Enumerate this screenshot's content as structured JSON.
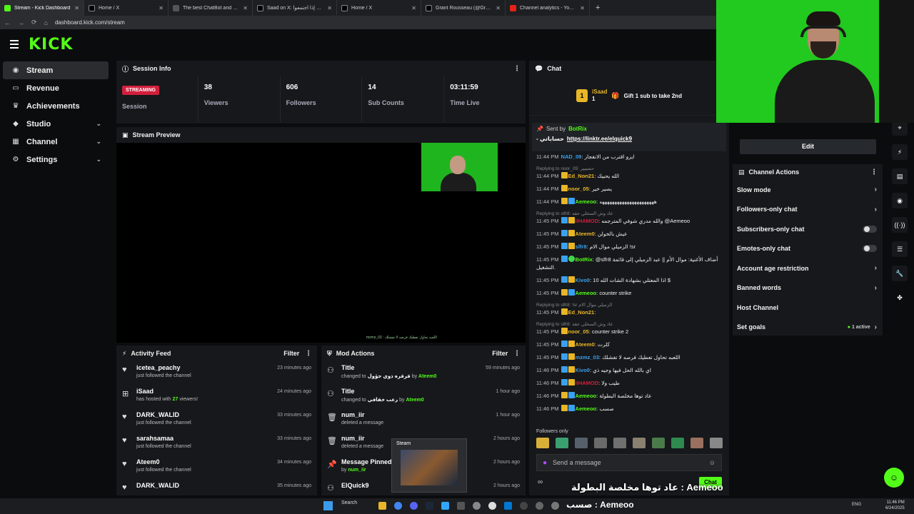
{
  "browser": {
    "tabs": [
      {
        "title": "Stream - Kick Dashboard",
        "icon": "kick-icon",
        "active": true
      },
      {
        "title": "Home / X",
        "icon": "x-icon"
      },
      {
        "title": "The best ChatBot and Widgets",
        "icon": "botrix-icon"
      },
      {
        "title": "Saad on X: وكويك إذا اجتمعوا",
        "icon": "x-icon"
      },
      {
        "title": "Home / X",
        "icon": "x-icon"
      },
      {
        "title": "Grant Rousseau (@GrantRous...",
        "icon": "x-icon"
      },
      {
        "title": "Channel analytics - YouTube St...",
        "icon": "youtube-icon"
      }
    ],
    "url": "dashboard.kick.com/stream"
  },
  "brand": {
    "logo": "KICK",
    "accent": "#53fc18"
  },
  "sidebar": {
    "items": [
      {
        "label": "Stream",
        "icon": "stream-icon"
      },
      {
        "label": "Revenue",
        "icon": "wallet-icon"
      },
      {
        "label": "Achievements",
        "icon": "trophy-icon"
      },
      {
        "label": "Studio",
        "icon": "location-icon"
      },
      {
        "label": "Channel",
        "icon": "channel-icon"
      },
      {
        "label": "Settings",
        "icon": "gear-icon"
      }
    ]
  },
  "session": {
    "title": "Session Info",
    "status": "STREAMING",
    "status_label": "Session",
    "stats": [
      {
        "value": "38",
        "label": "Viewers"
      },
      {
        "value": "606",
        "label": "Followers"
      },
      {
        "value": "14",
        "label": "Sub Counts"
      },
      {
        "value": "03:11:59",
        "label": "Time Live"
      }
    ]
  },
  "preview": {
    "title": "Stream Preview",
    "ticker": "mzmz_03 : اللعبه تحاول تعطيك فرصه لا تفشلك"
  },
  "activity": {
    "title": "Activity Feed",
    "filter": "Filter",
    "rows": [
      {
        "name": "icetea_peachy",
        "desc": "just followed the channel",
        "time": "23 minutes ago",
        "icon": "heart-icon"
      },
      {
        "name": "iSaad",
        "desc_pre": "has hosted with",
        "desc_num": "27",
        "desc_post": "viewers!",
        "time": "24 minutes ago",
        "icon": "host-icon"
      },
      {
        "name": "DARK_WALID",
        "desc": "just followed the channel",
        "time": "33 minutes ago",
        "icon": "heart-icon"
      },
      {
        "name": "sarahsamaa",
        "desc": "just followed the channel",
        "time": "33 minutes ago",
        "icon": "heart-icon"
      },
      {
        "name": "Ateem0",
        "desc": "just followed the channel",
        "time": "34 minutes ago",
        "icon": "heart-icon"
      },
      {
        "name": "DARK_WALID",
        "desc": "",
        "time": "35 minutes ago",
        "icon": "heart-icon"
      }
    ]
  },
  "modactions": {
    "title": "Mod Actions",
    "filter": "Filter",
    "rows": [
      {
        "name": "Title",
        "desc_pre": "changed to",
        "desc_bold": "قرقره ذوي جؤول",
        "by": "by",
        "user": "Ateem0",
        "time": "59 minutes ago",
        "icon": "users-icon"
      },
      {
        "name": "Title",
        "desc_pre": "changed to",
        "desc_bold": "رعب خفافي",
        "by": "by",
        "user": "Ateem0",
        "time": "1 hour ago",
        "icon": "users-icon"
      },
      {
        "name": "num_iir",
        "desc_pre": "deleted a message",
        "time": "1 hour ago",
        "icon": "trash-icon"
      },
      {
        "name": "num_iir",
        "desc_pre": "deleted a message",
        "time": "2 hours ago",
        "icon": "trash-icon"
      },
      {
        "name": "Message Pinned",
        "desc_pre": "by",
        "user": "num_iir",
        "time": "2 hours ago",
        "icon": "pin-icon"
      },
      {
        "name": "ElQuick9",
        "desc_pre": "",
        "time": "2 hours ago",
        "icon": "users-icon"
      }
    ]
  },
  "chat": {
    "title": "Chat",
    "gifter": {
      "name": "iSaad",
      "count": "1",
      "rank": "1",
      "text": "Gift 1 sub to take 2nd"
    },
    "pinned": {
      "sent_by": "Sent by",
      "user": "BotRix",
      "text": "حساباتي -",
      "link": "https://linktr.ee/elquick9"
    },
    "messages": [
      {
        "time": "11:44 PM",
        "user": "NAD_09",
        "color": "#3aa0f0",
        "text": "ايزو اقترب من الانفجار",
        "badges": []
      },
      {
        "reply": "Replying to noor_05: حسیبپر"
      },
      {
        "time": "11:44 PM",
        "user": "Ed_Non21",
        "color": "#e9b628",
        "text": "الله يحبيك",
        "badges": [
          "gold"
        ]
      },
      {
        "time": "11:44 PM",
        "user": "noor_05",
        "color": "#e9b628",
        "text": "يصير خير",
        "badges": [
          "gold"
        ]
      },
      {
        "time": "11:44 PM",
        "user": "Aemeoo",
        "color": "#53fc18",
        "text": "ههههههههههههههههههههههه",
        "badges": [
          "gold",
          "blue"
        ]
      },
      {
        "reply": "Replying to slfr8: عاد وش السخلي حقه"
      },
      {
        "time": "11:45 PM",
        "user": "iIHAMOD",
        "color": "#d21f3c",
        "text": "والله مدري شوفي المترجمه @Aemeoo",
        "badges": [
          "blue",
          "gold"
        ]
      },
      {
        "time": "11:45 PM",
        "user": "Ateem0",
        "color": "#e9b628",
        "text": "عيش بالخولن",
        "badges": [
          "blue",
          "gold"
        ]
      },
      {
        "time": "11:45 PM",
        "user": "slfr8",
        "color": "#3aa0f0",
        "text": "الزميلي موال الام !sr",
        "badges": [
          "blue",
          "gold"
        ]
      },
      {
        "time": "11:45 PM",
        "user": "BotRix",
        "color": "#53fc18",
        "text": "@slfr8 أضاف الأغنية: موال الأم || عبد الزميلي إلى قائمة التشغيل.",
        "badges": [
          "blue",
          "green"
        ]
      },
      {
        "time": "11:45 PM",
        "user": "Kivo0",
        "color": "#3aa0f0",
        "text": "اذا المعتلي بشهادة الشات الله 10 $",
        "badges": [
          "blue",
          "gold"
        ]
      },
      {
        "time": "11:45 PM",
        "user": "Aemeoo",
        "color": "#53fc18",
        "text": "counter strike",
        "badges": [
          "gold",
          "blue"
        ]
      },
      {
        "reply": "Replying to slfr8: !sr الزميلي موال الام"
      },
      {
        "time": "11:45 PM",
        "user": "Ed_Non21",
        "color": "#e9b628",
        "text": "",
        "badges": [
          "gold"
        ]
      },
      {
        "reply": "Replying to slfr8: عاد وش السخلي حقه"
      },
      {
        "time": "11:45 PM",
        "user": "noor_05",
        "color": "#e9b628",
        "text": "counter strike 2",
        "badges": [
          "gold"
        ]
      },
      {
        "time": "11:45 PM",
        "user": "Ateem0",
        "color": "#e9b628",
        "text": "كلرت",
        "badges": [
          "blue",
          "gold"
        ]
      },
      {
        "time": "11:45 PM",
        "user": "mzmz_03",
        "color": "#3aa0f0",
        "text": "اللعبه تحاول تعطيك فرصه لا تفشلك",
        "badges": [
          "blue",
          "gold"
        ]
      },
      {
        "time": "11:46 PM",
        "user": "Kivo0",
        "color": "#3aa0f0",
        "text": "اي بالله الحل فيها وجيه ذي",
        "badges": [
          "blue",
          "gold"
        ]
      },
      {
        "time": "11:46 PM",
        "user": "iIHAMOD",
        "color": "#d21f3c",
        "text": "طيب ولا",
        "badges": [
          "blue",
          "gold"
        ]
      },
      {
        "time": "11:46 PM",
        "user": "Aemeoo",
        "color": "#53fc18",
        "text": "عاد توها مخلصة البطولة",
        "badges": [
          "gold",
          "blue"
        ]
      },
      {
        "time": "11:46 PM",
        "user": "Aemeoo",
        "color": "#53fc18",
        "text": "صسب",
        "badges": [
          "gold",
          "blue"
        ]
      }
    ],
    "followers_only": "Followers only",
    "placeholder": "Send a message",
    "send_label": "Chat"
  },
  "right": {
    "edit_label": "Edit",
    "actions_title": "Channel Actions",
    "actions": [
      {
        "label": "Slow mode",
        "kind": "chevron"
      },
      {
        "label": "Followers-only chat",
        "kind": "chevron"
      },
      {
        "label": "Subscribers-only chat",
        "kind": "toggle"
      },
      {
        "label": "Emotes-only chat",
        "kind": "toggle"
      },
      {
        "label": "Account age restriction",
        "kind": "chevron"
      },
      {
        "label": "Banned words",
        "kind": "chevron"
      },
      {
        "label": "Host Channel",
        "kind": "none"
      },
      {
        "label": "Set goals",
        "kind": "chevron",
        "pill": "1 active"
      }
    ]
  },
  "overlay": {
    "thumbnail_label": "Steam",
    "caption": "عاد توها مخلصة البطولة : Aemeoo",
    "taskbar_caption": "صسب : Aemeoo",
    "search": "Search",
    "lang": "ENG",
    "clock_time": "11:46 PM",
    "clock_date": "6/24/2025"
  }
}
